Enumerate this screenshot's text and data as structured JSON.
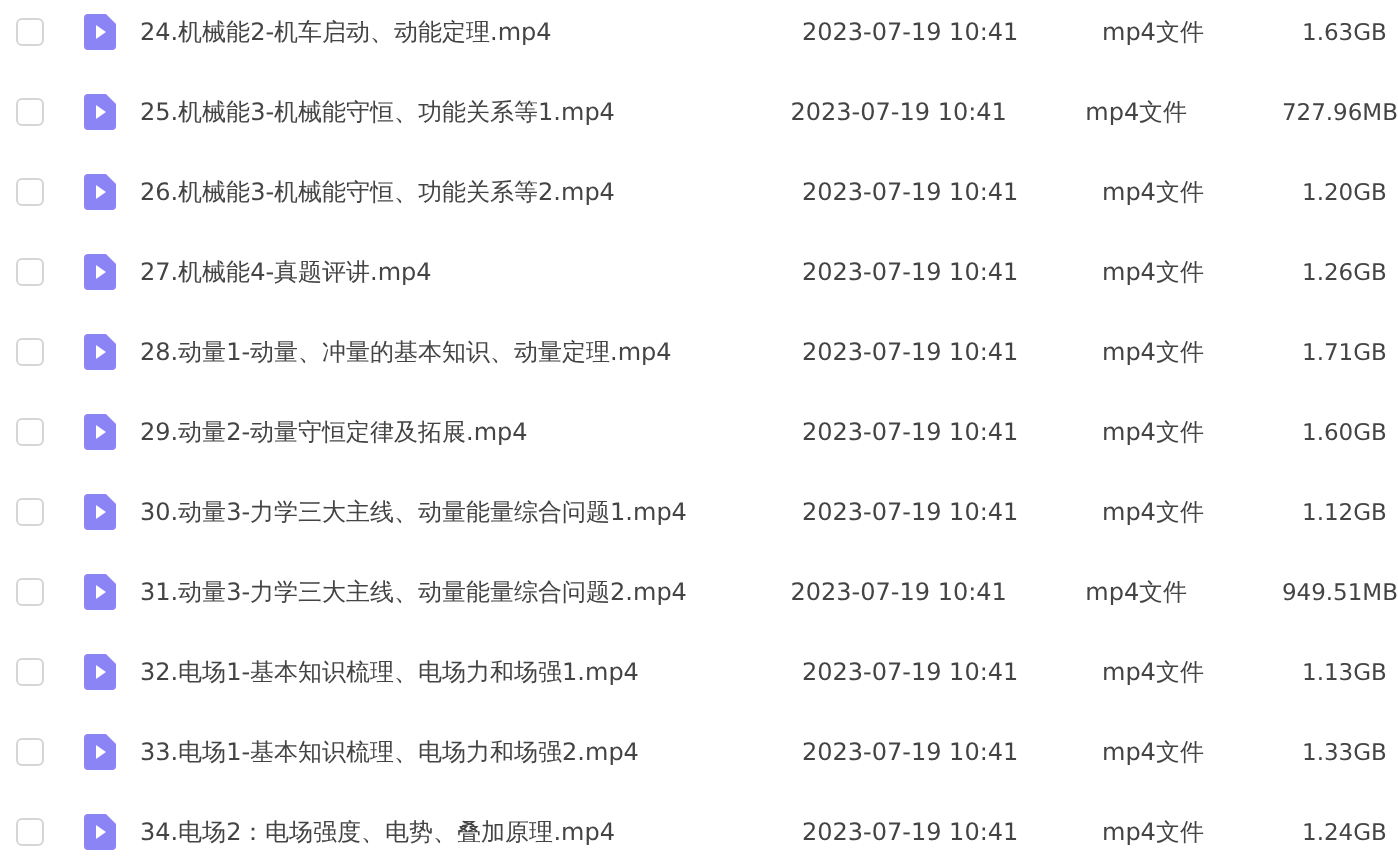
{
  "files": [
    {
      "name": "24.机械能2-机车启动、动能定理.mp4",
      "modified": "2023-07-19 10:41",
      "type": "mp4文件",
      "size": "1.63GB",
      "checked": false
    },
    {
      "name": "25.机械能3-机械能守恒、功能关系等1.mp4",
      "modified": "2023-07-19 10:41",
      "type": "mp4文件",
      "size": "727.96MB",
      "checked": false
    },
    {
      "name": "26.机械能3-机械能守恒、功能关系等2.mp4",
      "modified": "2023-07-19 10:41",
      "type": "mp4文件",
      "size": "1.20GB",
      "checked": false
    },
    {
      "name": "27.机械能4-真题评讲.mp4",
      "modified": "2023-07-19 10:41",
      "type": "mp4文件",
      "size": "1.26GB",
      "checked": false
    },
    {
      "name": "28.动量1-动量、冲量的基本知识、动量定理.mp4",
      "modified": "2023-07-19 10:41",
      "type": "mp4文件",
      "size": "1.71GB",
      "checked": false
    },
    {
      "name": "29.动量2-动量守恒定律及拓展.mp4",
      "modified": "2023-07-19 10:41",
      "type": "mp4文件",
      "size": "1.60GB",
      "checked": false
    },
    {
      "name": "30.动量3-力学三大主线、动量能量综合问题1.mp4",
      "modified": "2023-07-19 10:41",
      "type": "mp4文件",
      "size": "1.12GB",
      "checked": false
    },
    {
      "name": "31.动量3-力学三大主线、动量能量综合问题2.mp4",
      "modified": "2023-07-19 10:41",
      "type": "mp4文件",
      "size": "949.51MB",
      "checked": false
    },
    {
      "name": "32.电场1-基本知识梳理、电场力和场强1.mp4",
      "modified": "2023-07-19 10:41",
      "type": "mp4文件",
      "size": "1.13GB",
      "checked": false
    },
    {
      "name": "33.电场1-基本知识梳理、电场力和场强2.mp4",
      "modified": "2023-07-19 10:41",
      "type": "mp4文件",
      "size": "1.33GB",
      "checked": false
    },
    {
      "name": "34.电场2：电场强度、电势、叠加原理.mp4",
      "modified": "2023-07-19 10:41",
      "type": "mp4文件",
      "size": "1.24GB",
      "checked": false
    }
  ]
}
